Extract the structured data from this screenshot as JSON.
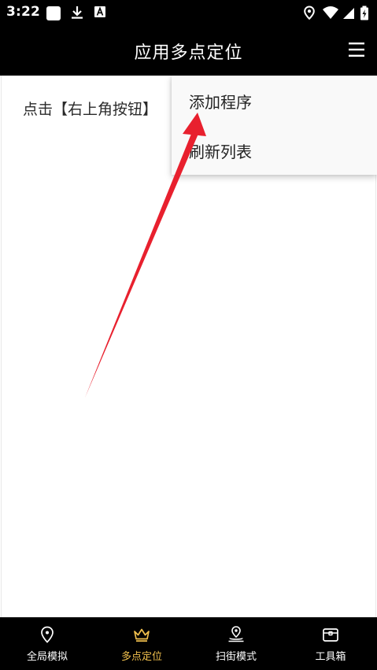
{
  "status_bar": {
    "time": "3:22",
    "left_icons": [
      "notification-square-icon",
      "download-icon",
      "font-a-icon"
    ],
    "right_icons": [
      "location-pin-icon",
      "wifi-icon",
      "cell-signal-icon",
      "battery-charging-icon"
    ]
  },
  "app_bar": {
    "title": "应用多点定位",
    "menu_icon": "hamburger-menu-icon"
  },
  "main": {
    "hint_text": "点击【右上角按钮】"
  },
  "dropdown_menu": {
    "items": [
      {
        "label": "添加程序"
      },
      {
        "label": "刷新列表"
      }
    ]
  },
  "annotation": {
    "arrow_color": "#e8202e"
  },
  "bottom_nav": {
    "active_color": "#f2c14e",
    "inactive_color": "#ffffff",
    "items": [
      {
        "label": "全局模拟",
        "icon": "location-pin-outline-icon",
        "active": false
      },
      {
        "label": "多点定位",
        "icon": "crown-icon",
        "active": true
      },
      {
        "label": "扫街模式",
        "icon": "map-pin-pulse-icon",
        "active": false
      },
      {
        "label": "工具箱",
        "icon": "toolbox-icon",
        "active": false
      }
    ]
  }
}
